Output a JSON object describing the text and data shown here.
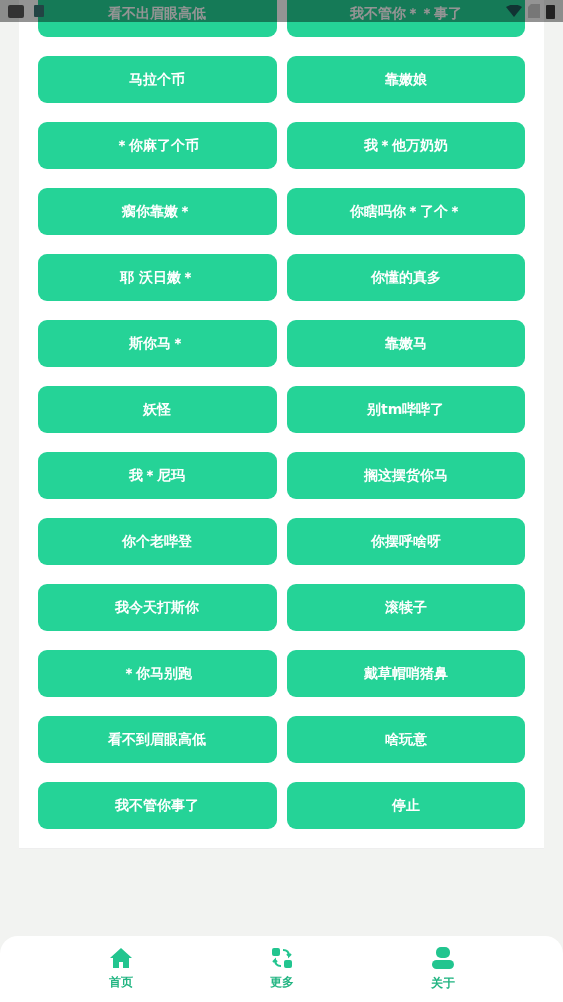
{
  "buttons": [
    {
      "label": "看不出眉眼高低"
    },
    {
      "label": "我不管你＊＊事了"
    },
    {
      "label": "马拉个币"
    },
    {
      "label": "靠嫩娘"
    },
    {
      "label": "＊你麻了个币"
    },
    {
      "label": "我＊他万奶奶"
    },
    {
      "label": "瘸你靠嫩＊"
    },
    {
      "label": "你瞎吗你＊了个＊"
    },
    {
      "label": "耶 沃日嫩＊"
    },
    {
      "label": "你懂的真多"
    },
    {
      "label": "斯你马＊"
    },
    {
      "label": "靠嫩马"
    },
    {
      "label": "妖怪"
    },
    {
      "label": "别tm哔哔了"
    },
    {
      "label": "我＊尼玛"
    },
    {
      "label": "搁这摆货你马"
    },
    {
      "label": "你个老哔登"
    },
    {
      "label": "你摆呼啥呀"
    },
    {
      "label": "我今天打斯你"
    },
    {
      "label": "滚犊子"
    },
    {
      "label": "＊你马别跑"
    },
    {
      "label": "戴草帽哨猪鼻"
    },
    {
      "label": "看不到眉眼高低"
    },
    {
      "label": "啥玩意"
    },
    {
      "label": "我不管你事了"
    },
    {
      "label": "停止"
    }
  ],
  "bottom_nav": [
    {
      "label": "首页",
      "kind": "home"
    },
    {
      "label": "更多",
      "kind": "more"
    },
    {
      "label": "关于",
      "kind": "about"
    }
  ]
}
